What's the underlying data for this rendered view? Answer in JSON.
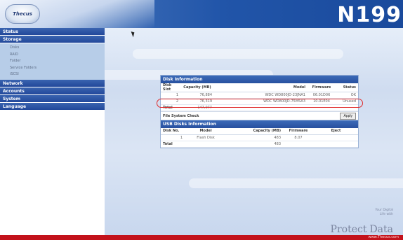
{
  "header": {
    "logo_text": "Thecus",
    "model": "N199"
  },
  "sidebar": {
    "items": [
      {
        "label": "Status"
      },
      {
        "label": "Storage",
        "sub": [
          "Disks",
          "RAID",
          "Folder",
          "Service Folders",
          "iSCSI"
        ]
      },
      {
        "label": "Network"
      },
      {
        "label": "Accounts"
      },
      {
        "label": "System"
      },
      {
        "label": "Language"
      }
    ]
  },
  "disk_info": {
    "title": "Disk Information",
    "columns": [
      "Disk Slot",
      "Capacity (MB)",
      "Model",
      "Firmware",
      "Status"
    ],
    "rows": [
      [
        "1",
        "76,884",
        "WDC WD800JD-23JNA1",
        "06.01D06",
        "OK"
      ],
      [
        "2",
        "76,319",
        "WDC WD800JD-75MSA3",
        "10.01E04",
        "Unused"
      ]
    ],
    "total_label": "Total",
    "total_value": "147,077",
    "fs_check_label": "File System Check",
    "apply_label": "Apply"
  },
  "usb_info": {
    "title": "USB Disks Information",
    "columns": [
      "Disk No.",
      "Model",
      "Capacity (MB)",
      "Firmware",
      "Eject"
    ],
    "rows": [
      [
        "1",
        "Flash Disk",
        "483",
        "8.07",
        ""
      ]
    ],
    "total_label": "Total",
    "total_value": "483"
  },
  "tagline": {
    "word1": "Protect",
    "small1": "Your Digital",
    "small2": "Life with",
    "word2": "Data"
  },
  "footer": {
    "url": "www.Thecus.com"
  },
  "colors": {
    "header_blue": "#2155a9",
    "menu_blue": "#22489a",
    "footer_red": "#c3121b",
    "highlight_red": "#e02a2a"
  }
}
